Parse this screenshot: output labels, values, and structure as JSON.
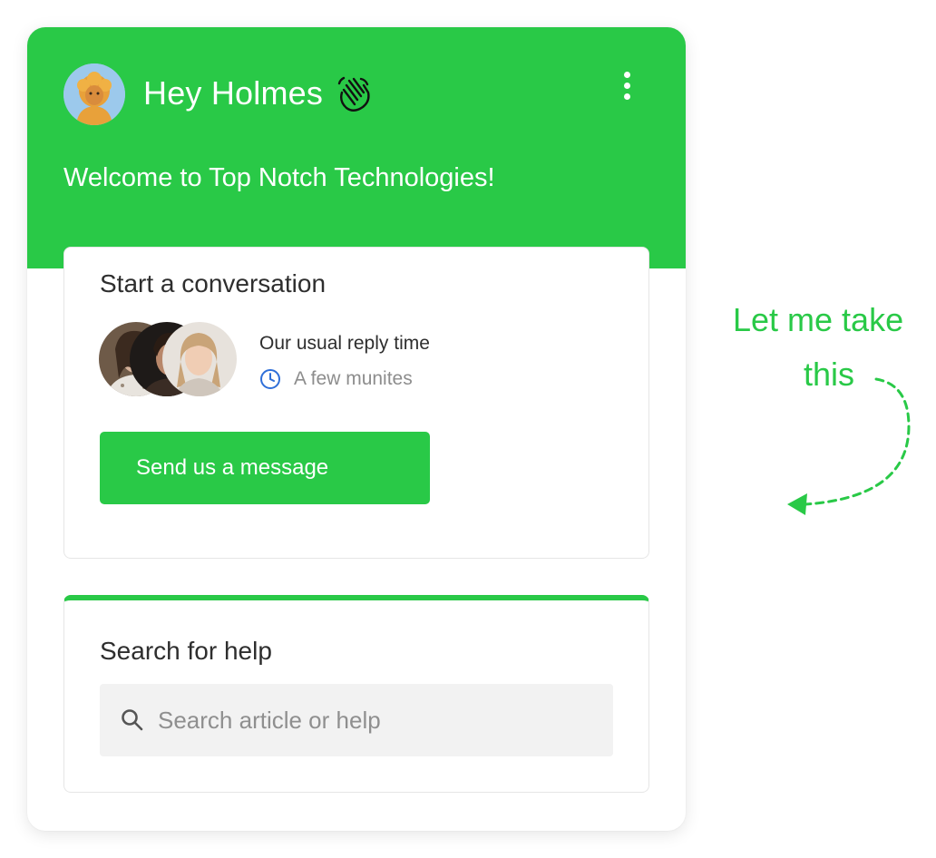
{
  "theme": {
    "accent": "#29c947",
    "card_border": "#e6e6e6",
    "muted_text": "#8d8d8d",
    "clock_color": "#2f6fd8"
  },
  "header": {
    "greeting": "Hey Holmes",
    "greeting_icon": "waving-hand-icon",
    "welcome": "Welcome to Top Notch Technologies!",
    "menu_icon": "more-vertical-icon"
  },
  "conversation": {
    "title": "Start a conversation",
    "reply_label": "Our usual reply time",
    "reply_time": "A few munites",
    "reply_icon": "clock-icon",
    "button_label": "Send us a message"
  },
  "search": {
    "title": "Search for help",
    "placeholder": "Search article or help",
    "value": "",
    "icon": "search-icon"
  },
  "annotation": {
    "line1": "Let me take",
    "line2": "this"
  }
}
